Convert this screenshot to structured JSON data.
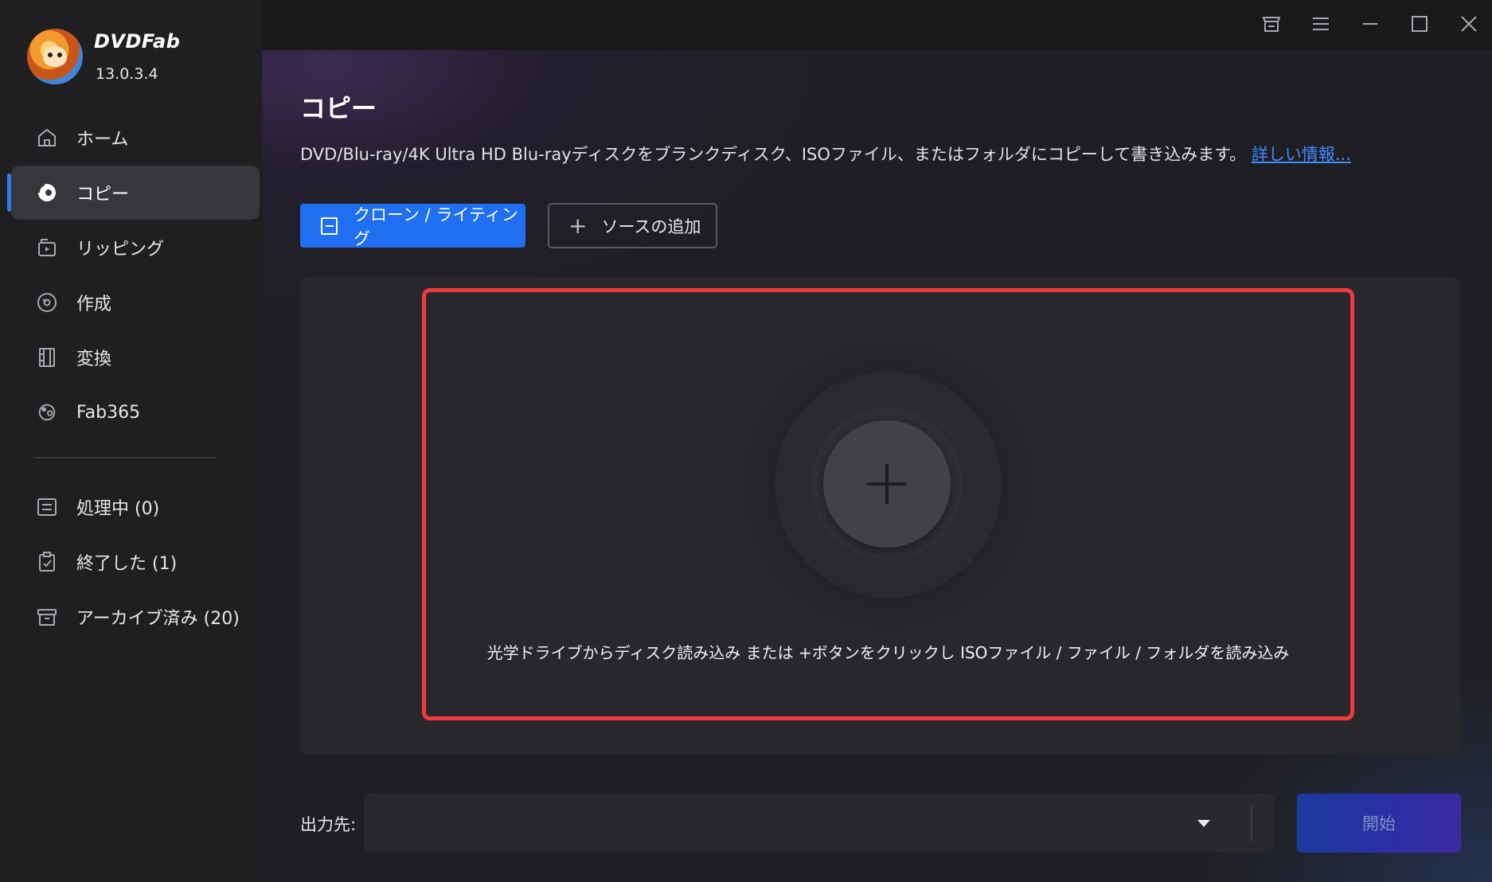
{
  "app": {
    "brand": "DVDFab",
    "version": "13.0.3.4"
  },
  "sidebar": {
    "items": [
      {
        "label": "ホーム",
        "icon": "home-icon",
        "active": false
      },
      {
        "label": "コピー",
        "icon": "disc-copy-icon",
        "active": true
      },
      {
        "label": "リッピング",
        "icon": "ripper-icon",
        "active": false
      },
      {
        "label": "作成",
        "icon": "creator-disc-icon",
        "active": false
      },
      {
        "label": "変換",
        "icon": "film-convert-icon",
        "active": false
      },
      {
        "label": "Fab365",
        "icon": "fab365-icon",
        "active": false
      }
    ],
    "queue": [
      {
        "label": "処理中 (0)",
        "icon": "task-list-icon"
      },
      {
        "label": "終了した (1)",
        "icon": "clipboard-check-icon"
      },
      {
        "label": "アーカイブ済み (20)",
        "icon": "archive-box-icon"
      }
    ]
  },
  "titlebar": {
    "icons": [
      "shop-icon",
      "menu-icon",
      "minimize-icon",
      "maximize-icon",
      "close-icon"
    ]
  },
  "main": {
    "title": "コピー",
    "description": "DVD/Blu-ray/4K Ultra HD Blu-rayディスクをブランクディスク、ISOファイル、またはフォルダにコピーして書き込みます。",
    "more_link": "詳しい情報...",
    "clone_button": "クローン / ライティング",
    "add_source_button": "ソースの追加",
    "drop_hint": "光学ドライブからディスク読み込み または +ボタンをクリックし ISOファイル / ファイル / フォルダを読み込み",
    "output_label": "出力先:",
    "output_value": "",
    "start_button": "開始"
  },
  "colors": {
    "accent": "#1f6ff0",
    "highlight_border": "#ef3a3a",
    "link": "#3f8cff",
    "active_nav_bg": "#36363b"
  }
}
